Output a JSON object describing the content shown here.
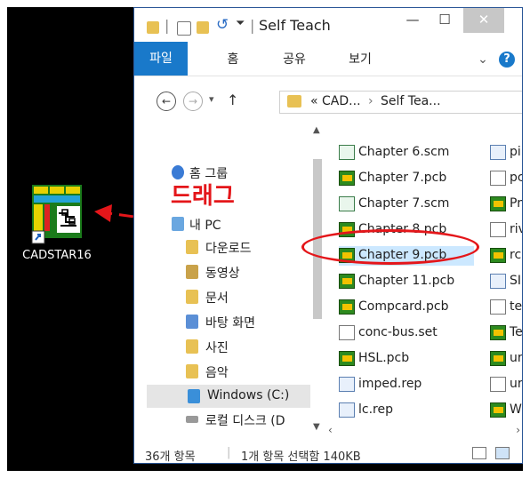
{
  "desktop": {
    "shortcut_label": "CADSTAR16"
  },
  "window": {
    "title": "Self Teach",
    "minimize_glyph": "—",
    "maximize_glyph": "☐",
    "close_glyph": "✕"
  },
  "ribbon": {
    "tabs": [
      "파일",
      "홈",
      "공유",
      "보기"
    ],
    "expand_glyph": "⌄",
    "help_glyph": "?"
  },
  "address": {
    "path_prefix": "«",
    "path_seg1": "CAD...",
    "path_sep": "›",
    "path_seg2": "Self Tea...",
    "chevron": "⌄"
  },
  "nav": {
    "items": [
      "홈 그룹",
      "내 PC",
      "다운로드",
      "동영상",
      "문서",
      "바탕 화면",
      "사진",
      "음악",
      "Windows (C:)",
      "로컬 디스크 (D"
    ]
  },
  "files": {
    "col1": [
      "Chapter 6.scm",
      "Chapter 7.pcb",
      "Chapter 7.scm",
      "Chapter 8.pcb",
      "Chapter 9.pcb",
      "Chapter 11.pcb",
      "Compcard.pcb",
      "conc-bus.set",
      "HSL.pcb",
      "imped.rep",
      "lc.rep"
    ],
    "col2": [
      "pi",
      "pc",
      "Pr",
      "riv",
      "rc",
      "SI",
      "te",
      "Te",
      "ur",
      "ur",
      "W"
    ]
  },
  "status": {
    "count": "36개 항목",
    "selection": "1개 항목 선택함 140KB"
  },
  "annotation": {
    "drag_label": "드래그"
  },
  "colors": {
    "accent": "#1979ca",
    "annotation_red": "#e4161a",
    "selection_bg": "#cce8ff",
    "desktop_bg": "#000000"
  }
}
